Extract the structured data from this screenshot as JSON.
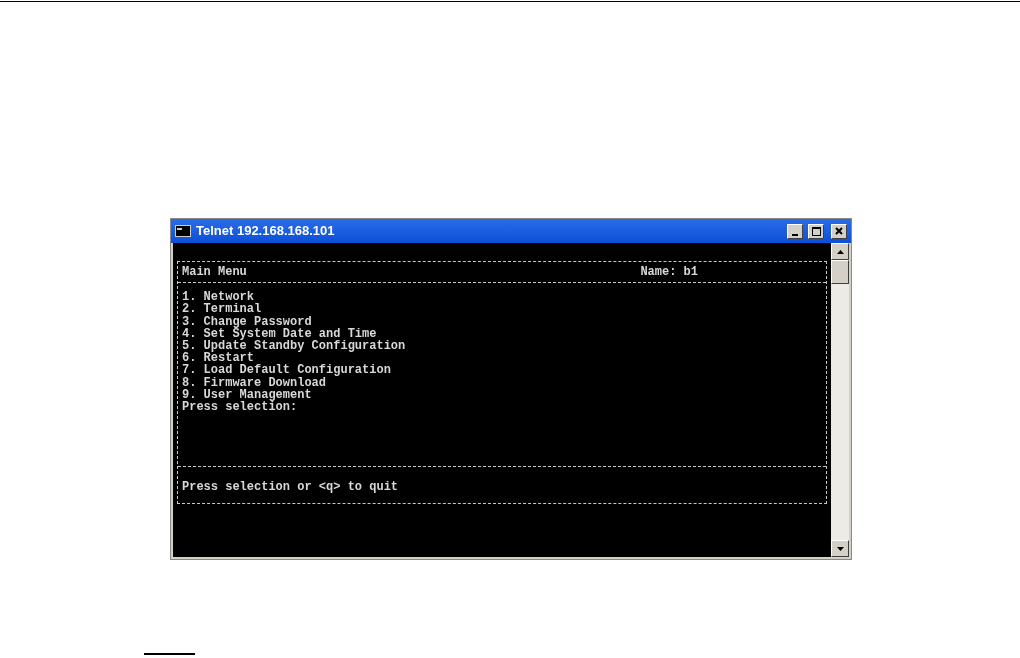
{
  "window": {
    "title": "Telnet 192.168.168.101"
  },
  "header": {
    "title": "Main Menu",
    "name": "Name: b1"
  },
  "menu_items": [
    "1. Network",
    "2. Terminal",
    "3. Change Password",
    "4. Set System Date and Time",
    "5. Update Standby Configuration",
    "6. Restart",
    "7. Load Default Configuration",
    "8. Firmware Download",
    "9. User Management"
  ],
  "prompt": "Press selection:",
  "footer": "Press selection or <q> to quit"
}
